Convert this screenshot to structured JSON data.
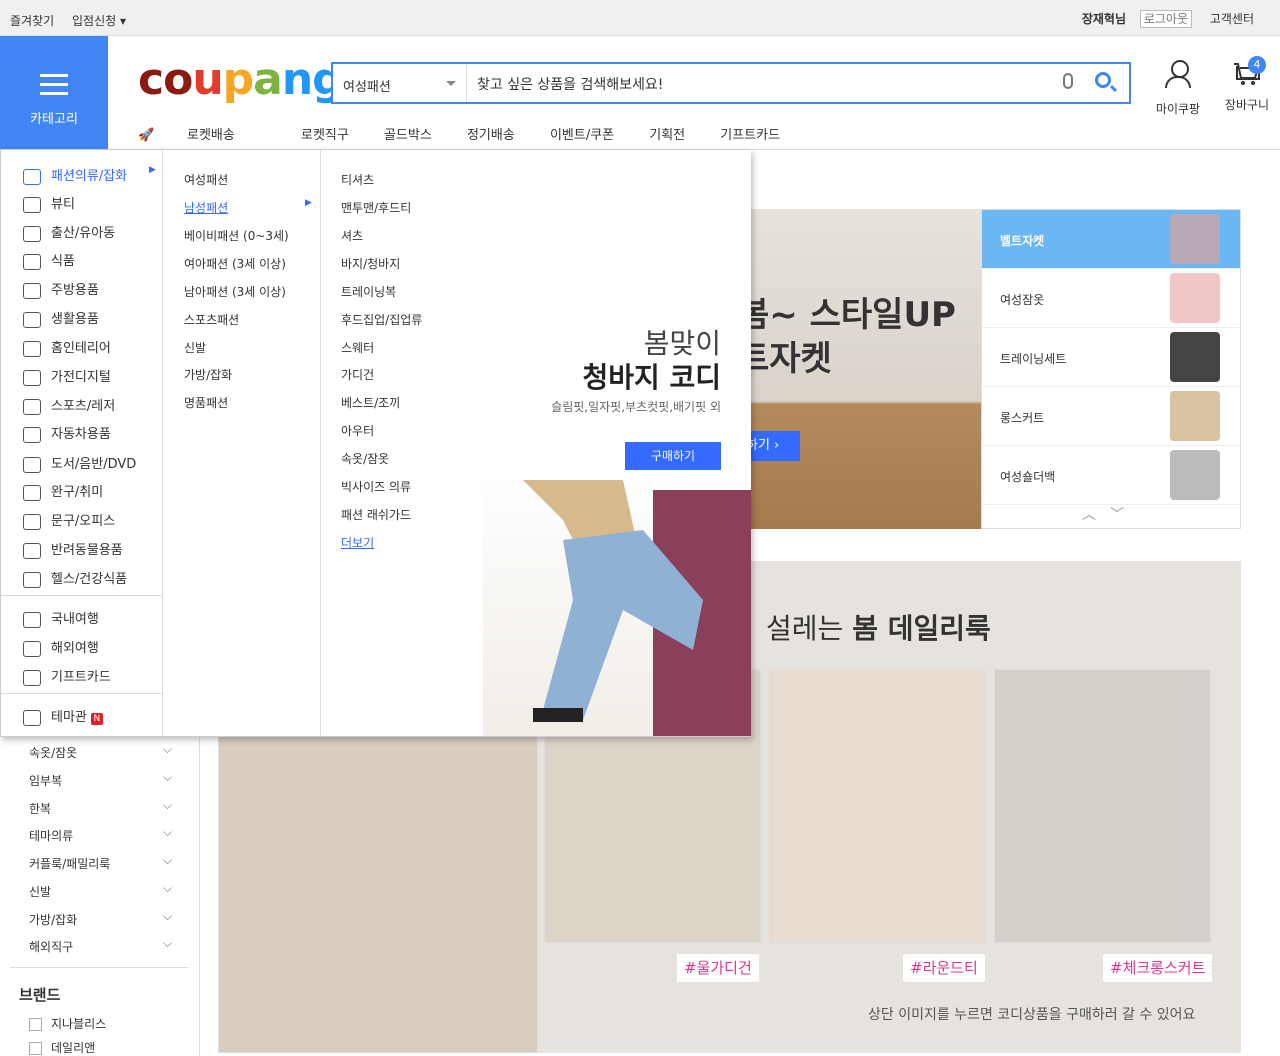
{
  "topbar": {
    "left": [
      "즐겨찾기",
      "입점신청 ▾"
    ],
    "user": "장재혁님",
    "logout": "로그아웃",
    "help": "고객센터"
  },
  "category_button": {
    "label": "카테고리"
  },
  "logo": {
    "text": "coupang"
  },
  "search": {
    "category": "여성패션",
    "placeholder": "찾고 싶은 상품을 검색해보세요!"
  },
  "header": {
    "mycoupang": "마이쿠팡",
    "cart": "장바구니",
    "cart_count": "4"
  },
  "nav": [
    "로켓배송",
    "로켓직구",
    "골드박스",
    "정기배송",
    "이벤트/쿠폰",
    "기획전",
    "기프트카드"
  ],
  "mega": {
    "col1a": [
      "패션의류/잡화",
      "뷰티",
      "출산/유아동",
      "식품",
      "주방용품",
      "생활용품",
      "홈인테리어",
      "가전디지털",
      "스포츠/레저",
      "자동차용품",
      "도서/음반/DVD",
      "완구/취미",
      "문구/오피스",
      "반려동물용품",
      "헬스/건강식품"
    ],
    "col1b": [
      "국내여행",
      "해외여행",
      "기프트카드"
    ],
    "col1c": [
      "테마관"
    ],
    "new_badge": "N",
    "col2": [
      "여성패션",
      "남성패션",
      "베이비패션 (0~3세)",
      "여아패션 (3세 이상)",
      "남아패션 (3세 이상)",
      "스포츠패션",
      "신발",
      "가방/잡화",
      "명품패션"
    ],
    "col3": [
      "티셔츠",
      "맨투맨/후드티",
      "셔츠",
      "바지/청바지",
      "트레이닝복",
      "후드집업/집업류",
      "스웨터",
      "가디건",
      "베스트/조끼",
      "아우터",
      "속옷/잠옷",
      "빅사이즈 의류",
      "패션 래쉬가드",
      "더보기"
    ],
    "promo": {
      "line1": "봄맞이",
      "line2": "청바지 코디",
      "line3": "슬림핏,일자핏,부츠컷핏,배기핏 외",
      "button": "구매하기"
    }
  },
  "hero": {
    "line1": "봄~ 스타일UP",
    "line2": "트자켓",
    "button": "하기 ›"
  },
  "side_list": [
    "벨트자켓",
    "여성잠옷",
    "트레이닝세트",
    "롱스커트",
    "여성숄더백"
  ],
  "lower": {
    "title_pre": "설레는 ",
    "title_bold": "봄 데일리룩",
    "tags": [
      "#울가디건",
      "#라운드티",
      "#체크롱스커트"
    ],
    "caption": "상단 이미지를 누르면 코디상품을 구매하러 갈 수 있어요"
  },
  "left_list": [
    "속옷/잠옷",
    "임부복",
    "한복",
    "테마의류",
    "커플룩/패밀리룩",
    "신발",
    "가방/잡화",
    "해외직구"
  ],
  "brand": {
    "title": "브랜드",
    "items": [
      "지나블리스",
      "데일리앤"
    ]
  },
  "colors": {
    "accent": "#346aff",
    "blue_button": "#4285f4",
    "tag_pink": "#e5338c"
  }
}
